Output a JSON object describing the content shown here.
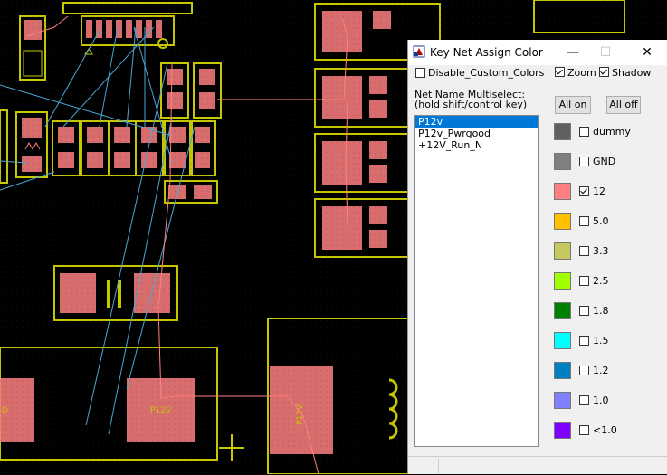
{
  "dialog": {
    "title": "Key Net Assign Color",
    "titlebar": {
      "minimize": "—",
      "maximize": "☐",
      "close": "✕"
    },
    "options": {
      "disable_custom_colors": {
        "label": "Disable_Custom_Colors",
        "checked": false
      },
      "zoom": {
        "label": "Zoom",
        "checked": true
      },
      "shadow": {
        "label": "Shadow",
        "checked": true
      }
    },
    "multiselect_label_1": "Net Name Multiselect:",
    "multiselect_label_2": "(hold shift/control key)",
    "nets": [
      {
        "name": "P12v",
        "selected": true
      },
      {
        "name": "P12v_Pwrgood",
        "selected": false
      },
      {
        "name": "+12V_Run_N",
        "selected": false
      }
    ],
    "all_on": "All on",
    "all_off": "All off",
    "colors": [
      {
        "label": "dummy",
        "color": "#606060",
        "checked": false
      },
      {
        "label": "GND",
        "color": "#808080",
        "checked": false
      },
      {
        "label": "12",
        "color": "#ff8080",
        "checked": true
      },
      {
        "label": "5.0",
        "color": "#ffc000",
        "checked": false
      },
      {
        "label": "3.3",
        "color": "#c8c860",
        "checked": false
      },
      {
        "label": "2.5",
        "color": "#a0ff00",
        "checked": false
      },
      {
        "label": "1.8",
        "color": "#008000",
        "checked": false
      },
      {
        "label": "1.5",
        "color": "#00ffff",
        "checked": false
      },
      {
        "label": "1.2",
        "color": "#0080c0",
        "checked": false
      },
      {
        "label": "1.0",
        "color": "#8080ff",
        "checked": false
      },
      {
        "label": "<1.0",
        "color": "#8000ff",
        "checked": false
      }
    ]
  },
  "pcb": {
    "labels": {
      "pad_left": "D",
      "pad_mid": "P12V",
      "pad_right": "P12V"
    },
    "colors": {
      "silkscreen": "#c8c800",
      "copper_net": "#ff8080",
      "ratsnest": "#4aa8d8",
      "background": "#000000"
    }
  }
}
